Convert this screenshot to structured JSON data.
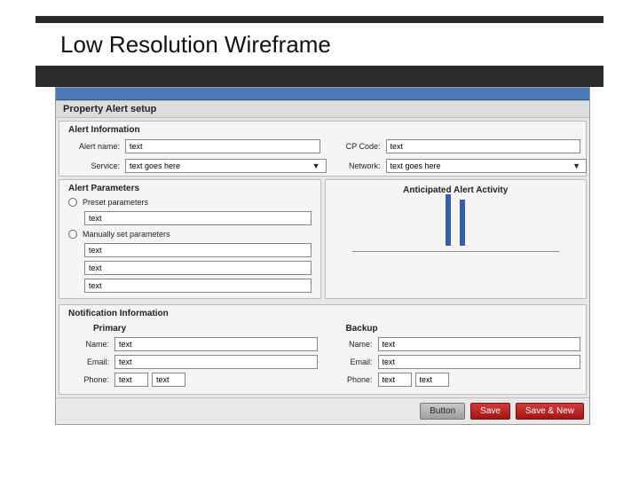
{
  "slide": {
    "title": "Low Resolution Wireframe"
  },
  "app": {
    "title": "Property Alert setup",
    "alert_info": {
      "heading": "Alert Information",
      "alert_name_label": "Alert name:",
      "alert_name_value": "text",
      "cp_code_label": "CP Code:",
      "cp_code_value": "text",
      "service_label": "Service:",
      "service_value": "text goes here",
      "network_label": "Network:",
      "network_value": "text goes here"
    },
    "alert_params": {
      "heading": "Alert Parameters",
      "preset_label": "Preset parameters",
      "preset_field": "text",
      "manual_label": "Manually set parameters",
      "manual_fields": [
        "text",
        "text",
        "text"
      ],
      "activity_title": "Anticipated Alert Activity"
    },
    "notif": {
      "heading": "Notification Information",
      "primary": "Primary",
      "backup": "Backup",
      "name_label": "Name:",
      "email_label": "Email:",
      "phone_label": "Phone:",
      "p_name": "text",
      "p_email": "text",
      "p_phone1": "text",
      "p_phone2": "text",
      "b_name": "text",
      "b_email": "text",
      "b_phone1": "text",
      "b_phone2": "text"
    },
    "buttons": {
      "button": "Button",
      "save": "Save",
      "save_new": "Save & New"
    }
  },
  "chart_data": {
    "type": "bar",
    "categories": [
      "",
      ""
    ],
    "values": [
      58,
      52
    ],
    "title": "Anticipated Alert Activity",
    "xlabel": "",
    "ylabel": "",
    "ylim": [
      0,
      60
    ]
  }
}
